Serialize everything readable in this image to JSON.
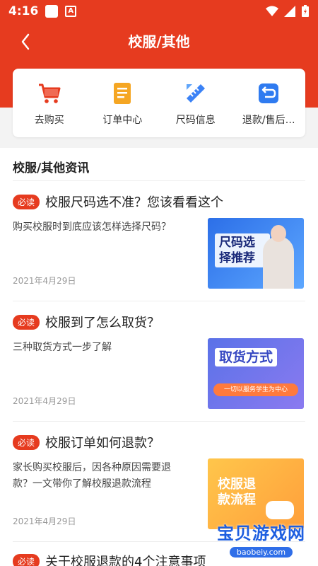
{
  "status": {
    "time": "4:16"
  },
  "header": {
    "title": "校服/其他"
  },
  "quick_actions": [
    {
      "label": "去购买",
      "icon": "shopping-cart-icon"
    },
    {
      "label": "订单中心",
      "icon": "clipboard-icon"
    },
    {
      "label": "尺码信息",
      "icon": "ruler-icon"
    },
    {
      "label": "退款/售后…",
      "icon": "return-icon"
    }
  ],
  "news": {
    "section_title": "校服/其他资讯",
    "badge": "必读",
    "articles": [
      {
        "headline": "校服尺码选不准？您该看看这个",
        "summary": "购买校服时到底应该怎样选择尺码？",
        "date": "2021年4月29日",
        "thumb_text": "尺码选择推荐"
      },
      {
        "headline": "校服到了怎么取货？",
        "summary": "三种取货方式一步了解",
        "date": "2021年4月29日",
        "thumb_text": "取货方式",
        "thumb_sub": "一切以服务学生为中心"
      },
      {
        "headline": "校服订单如何退款？",
        "summary": "家长购买校服后，因各种原因需要退款？一文带你了解校服退款流程",
        "date": "2021年4月29日",
        "thumb_text": "校服退款流程"
      }
    ],
    "last_headline": "关于校服退款的4个注意事项"
  },
  "watermark": {
    "main": "宝贝游戏网",
    "sub": "baobeiy.com"
  },
  "colors": {
    "accent": "#e63b1f"
  }
}
